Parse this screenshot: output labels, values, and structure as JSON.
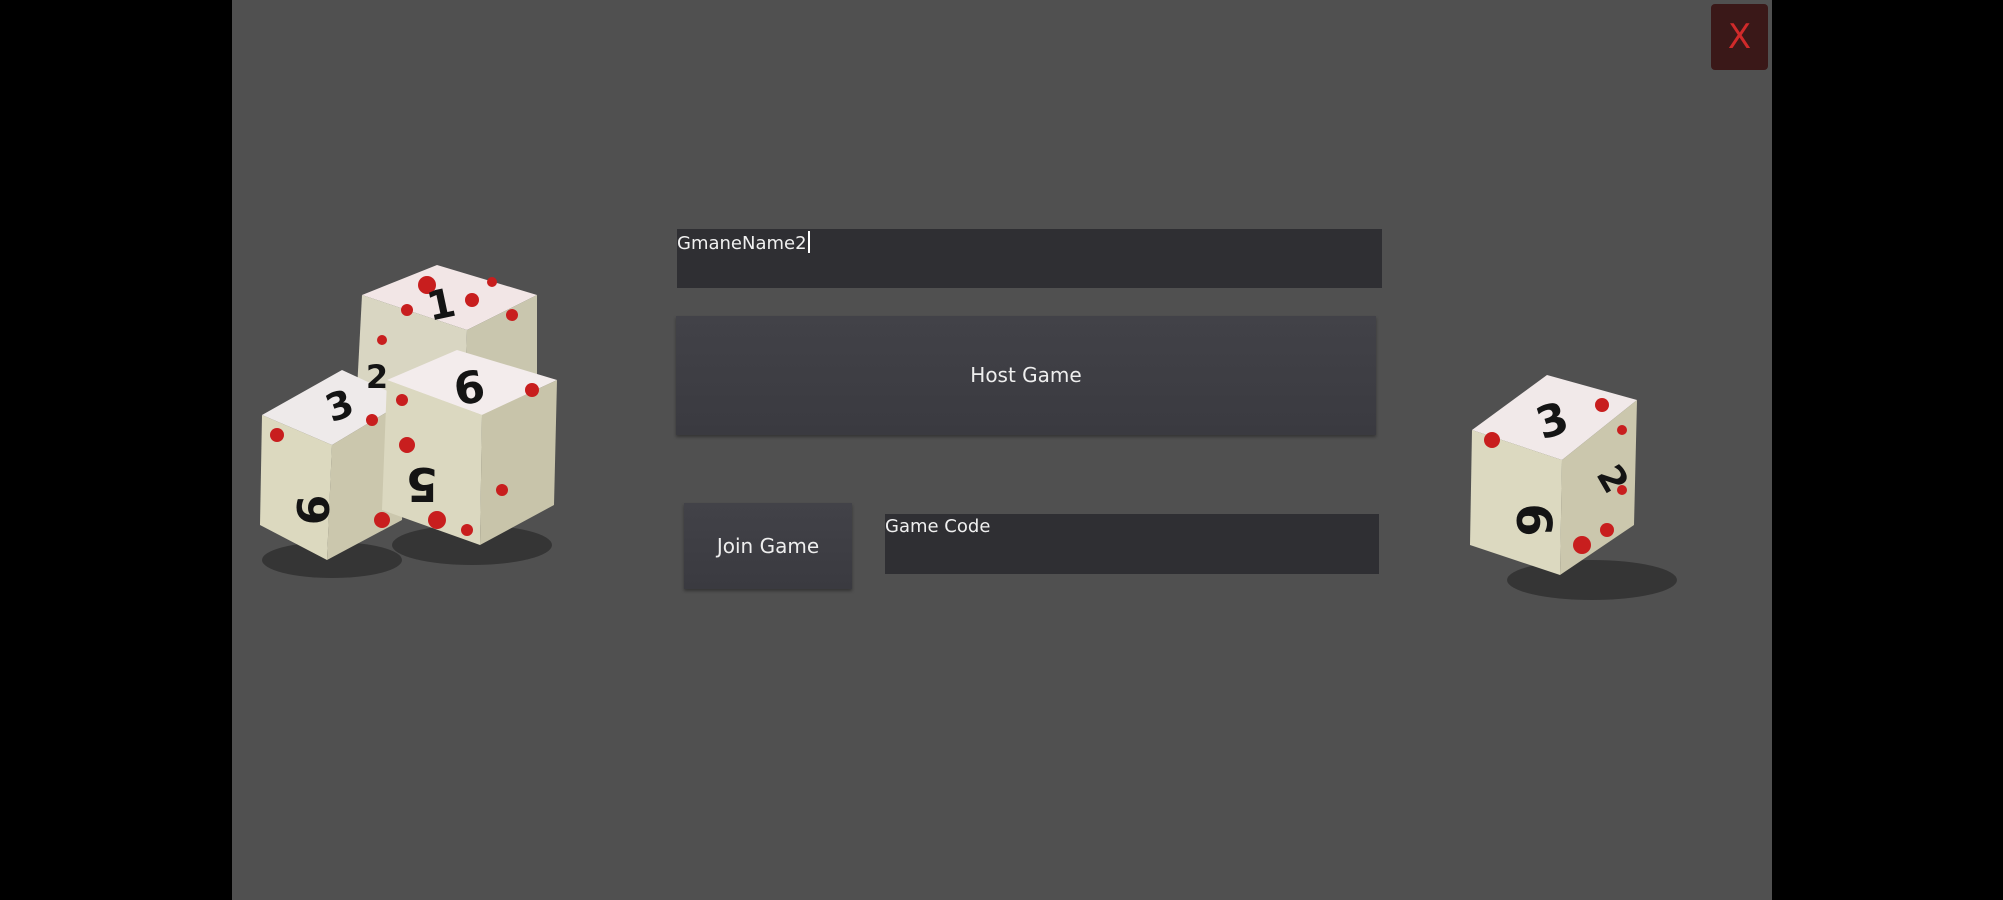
{
  "window": {
    "close_icon": "close-x-icon",
    "close_glyph": "X",
    "accent_color": "#d02a2a"
  },
  "host_section": {
    "game_name_value": "GmaneName2",
    "host_button_label": "Host Game"
  },
  "join_section": {
    "join_button_label": "Join Game",
    "game_code_placeholder": "Game Code"
  },
  "decor": {
    "dice_left": {
      "top_die_face": "1",
      "back_die_face": "3",
      "back_die_side": "9",
      "front_die_face": "6",
      "front_die_side": "5",
      "hidden_face": "2"
    },
    "dice_right": {
      "top_face": "3",
      "front_face": "6",
      "side_face": "2"
    }
  }
}
